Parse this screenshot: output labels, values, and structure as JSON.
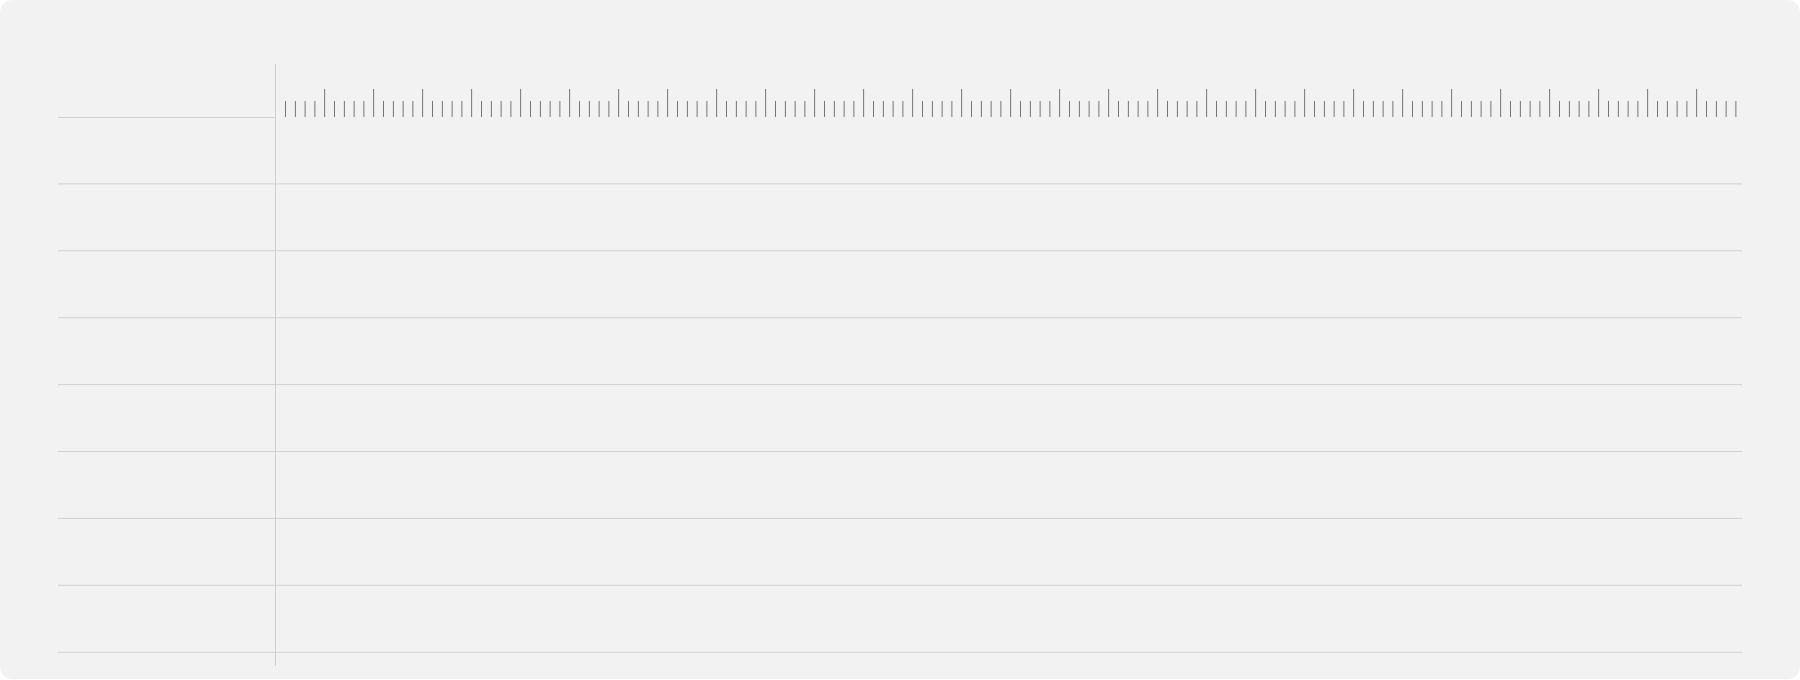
{
  "window": {
    "background_color": "#f2f2f2",
    "gridline_color": "#d0d0d0",
    "tick_color": "#555555"
  },
  "ruler": {
    "label_text": [],
    "ticks_per_major": 5,
    "major_tick_count": 30
  },
  "track_list": {
    "rows": [
      {
        "label": ""
      },
      {
        "label": ""
      },
      {
        "label": ""
      },
      {
        "label": ""
      },
      {
        "label": ""
      },
      {
        "label": ""
      },
      {
        "label": ""
      },
      {
        "label": ""
      }
    ]
  }
}
